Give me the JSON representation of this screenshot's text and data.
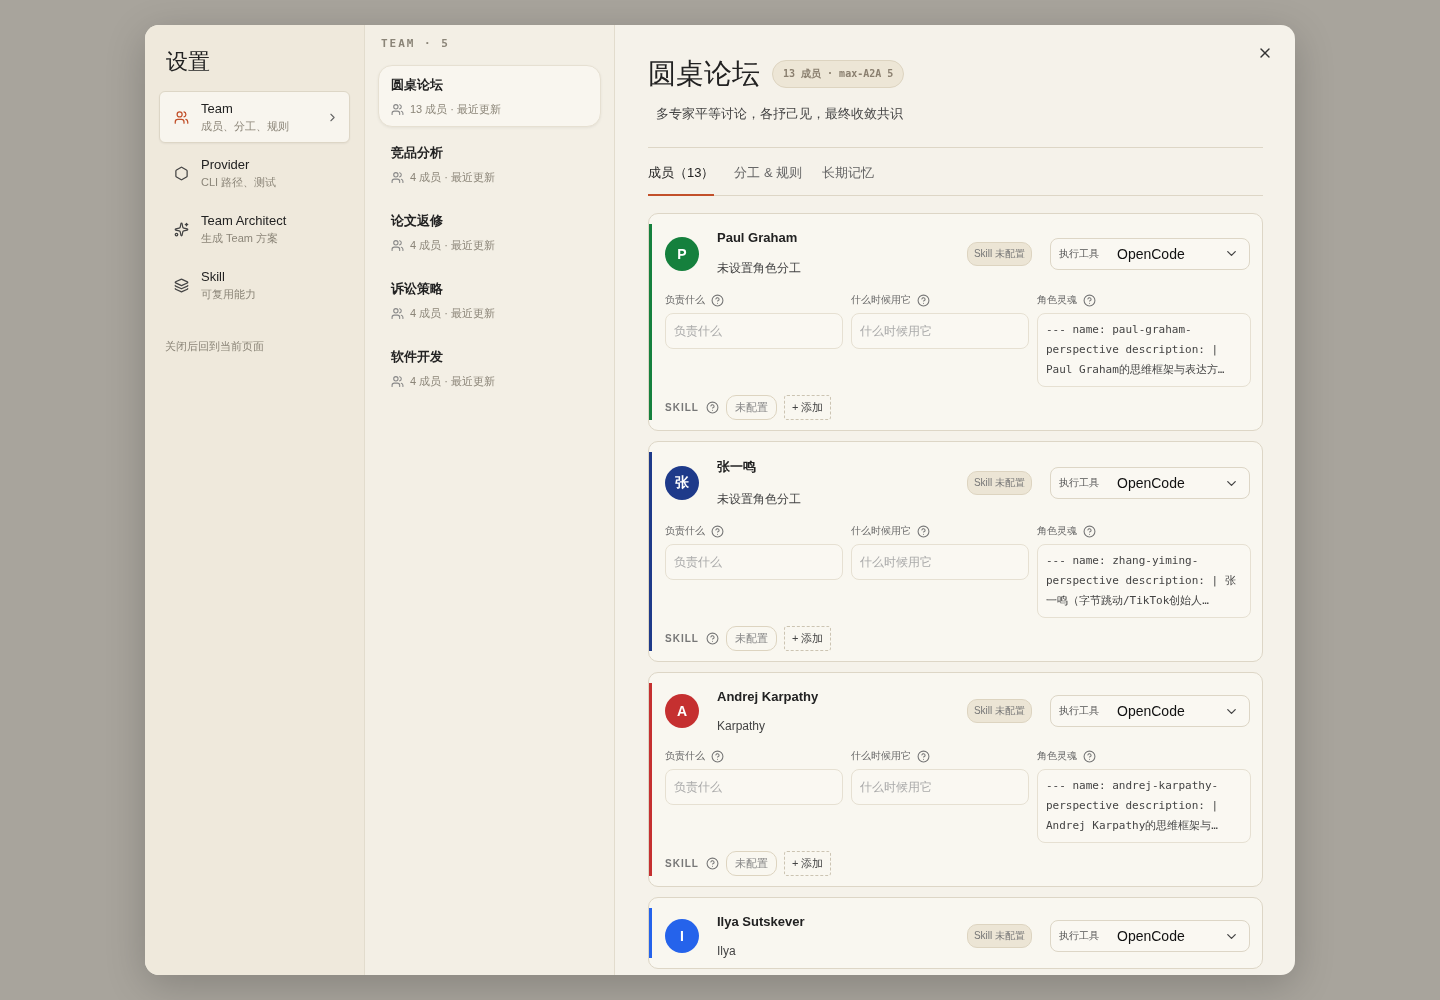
{
  "sidebar": {
    "title": "设置",
    "items": [
      {
        "kind": "team",
        "label": "Team",
        "sub": "成员、分工、规则",
        "selected": true
      },
      {
        "kind": "provider",
        "label": "Provider",
        "sub": "CLI 路径、测试",
        "selected": false
      },
      {
        "kind": "architect",
        "label": "Team Architect",
        "sub": "生成 Team 方案",
        "selected": false
      },
      {
        "kind": "skill",
        "label": "Skill",
        "sub": "可复用能力",
        "selected": false
      }
    ],
    "footer": "关闭后回到当前页面"
  },
  "team_list": {
    "heading": "TEAM · 5",
    "items": [
      {
        "name": "圆桌论坛",
        "meta": "13 成员 · 最近更新",
        "selected": true
      },
      {
        "name": "竞品分析",
        "meta": "4 成员 · 最近更新",
        "selected": false
      },
      {
        "name": "论文返修",
        "meta": "4 成员 · 最近更新",
        "selected": false
      },
      {
        "name": "诉讼策略",
        "meta": "4 成员 · 最近更新",
        "selected": false
      },
      {
        "name": "软件开发",
        "meta": "4 成员 · 最近更新",
        "selected": false
      }
    ]
  },
  "detail": {
    "title": "圆桌论坛",
    "badge": "13 成员 · max-A2A 5",
    "description": "多专家平等讨论，各抒己见，最终收敛共识",
    "tabs": [
      {
        "label": "成员（13）",
        "selected": true
      },
      {
        "label": "分工 & 规则",
        "selected": false
      },
      {
        "label": "长期记忆",
        "selected": false
      }
    ],
    "members": [
      {
        "initial": "P",
        "name": "Paul Graham",
        "role": "未设置角色分工",
        "color": "#15803d",
        "skill_badge": "Skill 未配置",
        "tool_label": "执行工具",
        "tool": "OpenCode",
        "fields": [
          {
            "label": "负责什么",
            "placeholder": "负责什么"
          },
          {
            "label": "什么时候用它",
            "placeholder": "什么时候用它"
          }
        ],
        "soul_label": "角色灵魂",
        "soul": "--- name: paul-graham-perspective description: | Paul Graham的思维框架与表达方…",
        "skill_label": "SKILL",
        "skill_state": "未配置",
        "add": "+ 添加"
      },
      {
        "initial": "张",
        "name": "张一鸣",
        "role": "未设置角色分工",
        "color": "#1e3a8a",
        "skill_badge": "Skill 未配置",
        "tool_label": "执行工具",
        "tool": "OpenCode",
        "fields": [
          {
            "label": "负责什么",
            "placeholder": "负责什么"
          },
          {
            "label": "什么时候用它",
            "placeholder": "什么时候用它"
          }
        ],
        "soul_label": "角色灵魂",
        "soul": "--- name: zhang-yiming-perspective description: | 张一鸣（字节跳动/TikTok创始人…",
        "skill_label": "SKILL",
        "skill_state": "未配置",
        "add": "+ 添加"
      },
      {
        "initial": "A",
        "name": "Andrej Karpathy",
        "role": "Karpathy",
        "color": "#c53030",
        "skill_badge": "Skill 未配置",
        "tool_label": "执行工具",
        "tool": "OpenCode",
        "fields": [
          {
            "label": "负责什么",
            "placeholder": "负责什么"
          },
          {
            "label": "什么时候用它",
            "placeholder": "什么时候用它"
          }
        ],
        "soul_label": "角色灵魂",
        "soul": "--- name: andrej-karpathy-perspective description: | Andrej Karpathy的思维框架与…",
        "skill_label": "SKILL",
        "skill_state": "未配置",
        "add": "+ 添加"
      },
      {
        "initial": "I",
        "name": "Ilya Sutskever",
        "role": "Ilya",
        "color": "#2563eb",
        "skill_badge": "Skill 未配置",
        "tool_label": "执行工具",
        "tool": "OpenCode"
      }
    ]
  }
}
